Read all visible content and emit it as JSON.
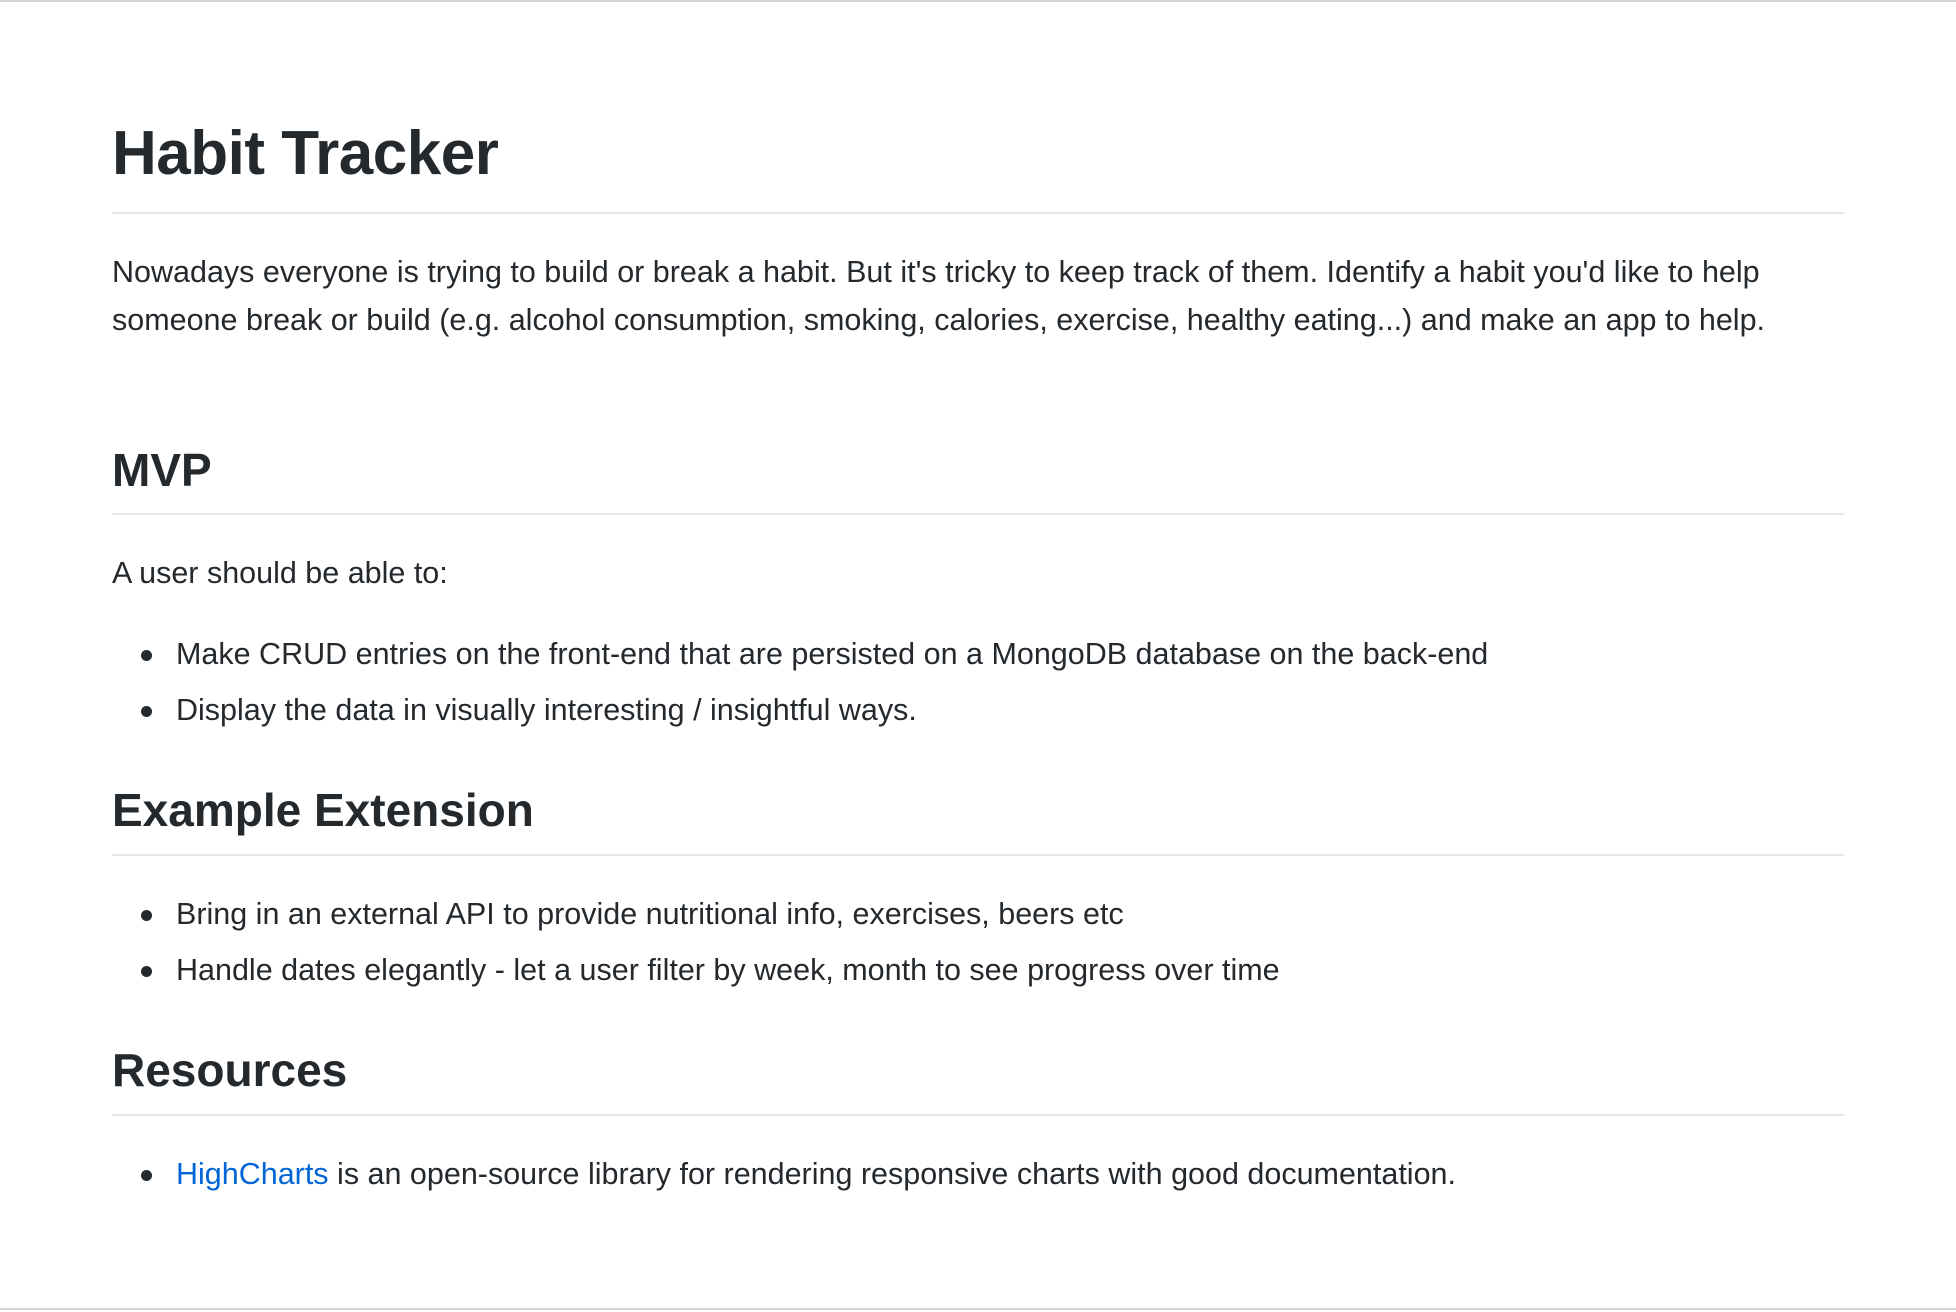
{
  "document": {
    "title": "Habit Tracker",
    "intro": "Nowadays everyone is trying to build or break a habit. But it's tricky to keep track of them. Identify a habit you'd like to help someone break or build (e.g. alcohol consumption, smoking, calories, exercise, healthy eating...) and make an app to help.",
    "mvp": {
      "heading": "MVP",
      "lead": "A user should be able to:",
      "items": [
        "Make CRUD entries on the front-end that are persisted on a MongoDB database on the back-end",
        "Display the data in visually interesting / insightful ways."
      ]
    },
    "extension": {
      "heading": "Example Extension",
      "items": [
        "Bring in an external API to provide nutritional info, exercises, beers etc",
        "Handle dates elegantly - let a user filter by week, month to see progress over time"
      ]
    },
    "resources": {
      "heading": "Resources",
      "items": [
        {
          "link_text": "HighCharts",
          "text": " is an open-source library for rendering responsive charts with good documentation."
        }
      ]
    }
  },
  "colors": {
    "text": "#24292e",
    "link": "#0366d6",
    "rule": "#e4e7eb"
  }
}
